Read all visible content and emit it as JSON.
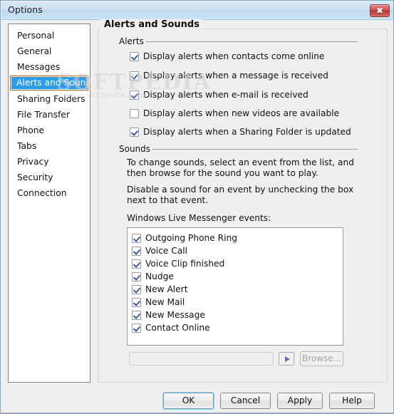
{
  "window": {
    "title": "Options",
    "close_label": "✖"
  },
  "sidebar": {
    "items": [
      {
        "label": "Personal",
        "selected": false
      },
      {
        "label": "General",
        "selected": false
      },
      {
        "label": "Messages",
        "selected": false
      },
      {
        "label": "Alerts and Sounds",
        "selected": true
      },
      {
        "label": "Sharing Folders",
        "selected": false
      },
      {
        "label": "File Transfer",
        "selected": false
      },
      {
        "label": "Phone",
        "selected": false
      },
      {
        "label": "Tabs",
        "selected": false
      },
      {
        "label": "Privacy",
        "selected": false
      },
      {
        "label": "Security",
        "selected": false
      },
      {
        "label": "Connection",
        "selected": false
      }
    ]
  },
  "main": {
    "title": "Alerts and Sounds",
    "alerts_group": {
      "label": "Alerts",
      "checkboxes": [
        {
          "label": "Display alerts when contacts come online",
          "checked": true
        },
        {
          "label": "Display alerts when a message is received",
          "checked": true
        },
        {
          "label": "Display alerts when e-mail is received",
          "checked": true
        },
        {
          "label": "Display alerts when new videos are available",
          "checked": false
        },
        {
          "label": "Display alerts when a Sharing Folder is updated",
          "checked": true
        }
      ]
    },
    "sounds_group": {
      "label": "Sounds",
      "paragraph1": "To change sounds, select an event from the list, and then browse for the sound you want to play.",
      "paragraph2": "Disable a sound for an event by unchecking the box next to that event.",
      "events_label": "Windows Live Messenger events:",
      "events": [
        {
          "label": "Outgoing Phone Ring",
          "checked": true
        },
        {
          "label": "Voice Call",
          "checked": true
        },
        {
          "label": "Voice Clip finished",
          "checked": true
        },
        {
          "label": "Nudge",
          "checked": true
        },
        {
          "label": "New Alert",
          "checked": true
        },
        {
          "label": "New Mail",
          "checked": true
        },
        {
          "label": "New Message",
          "checked": true
        },
        {
          "label": "Contact Online",
          "checked": true
        }
      ],
      "sound_path_value": "",
      "sound_path_placeholder": "",
      "play_label": "▶",
      "browse_label": "Browse..."
    }
  },
  "footer": {
    "ok": "OK",
    "cancel": "Cancel",
    "apply": "Apply",
    "help": "Help"
  },
  "watermark": {
    "main": "SOFTPEDIA",
    "sub": "www.softpedia.com"
  },
  "colors": {
    "selection_blue": "#2a9ce8",
    "selection_border": "#b8651f",
    "checkmark": "#3a5fa8",
    "close_red": "#bc3333",
    "titlebar_blue": "#cfe3f4"
  }
}
